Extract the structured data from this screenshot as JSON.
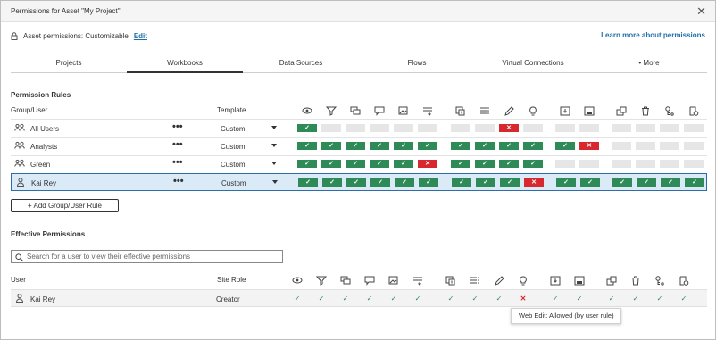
{
  "dialog": {
    "title": "Permissions for Asset \"My Project\"",
    "close_glyph": "✕",
    "asset_permissions_label": "Asset permissions: Customizable",
    "edit_link": "Edit",
    "learn_more_link": "Learn more about permissions"
  },
  "tabs": [
    {
      "label": "Projects",
      "active": false
    },
    {
      "label": "Workbooks",
      "active": true
    },
    {
      "label": "Data Sources",
      "active": false
    },
    {
      "label": "Flows",
      "active": false
    },
    {
      "label": "Virtual Connections",
      "active": false
    },
    {
      "label": "• More",
      "active": false
    }
  ],
  "permission_rules": {
    "section_title": "Permission Rules",
    "col_group_user": "Group/User",
    "col_template": "Template",
    "capability_icons": [
      "view-icon",
      "filter-icon",
      "comments-icon",
      "web-comment-icon",
      "export-image-icon",
      "export-data-icon",
      "download-full-data-icon",
      "share-customized-icon",
      "web-edit-icon",
      "explain-data-icon",
      "download-workbook-icon",
      "overwrite-icon",
      "move-icon",
      "delete-icon",
      "set-permissions-icon",
      "run-explain-icon"
    ],
    "more_glyph": "•••",
    "rows": [
      {
        "name": "All Users",
        "icon": "group-icon",
        "template": "Custom",
        "selected": false,
        "cells": [
          "allow",
          "none",
          "none",
          "none",
          "none",
          "none",
          "none",
          "none",
          "deny",
          "none",
          "none",
          "none",
          "none",
          "none",
          "none",
          "none"
        ]
      },
      {
        "name": "Analysts",
        "icon": "group-icon",
        "template": "Custom",
        "selected": false,
        "cells": [
          "allow",
          "allow",
          "allow",
          "allow",
          "allow",
          "allow",
          "allow",
          "allow",
          "allow",
          "allow",
          "allow",
          "deny",
          "none",
          "none",
          "none",
          "none"
        ]
      },
      {
        "name": "Green",
        "icon": "group-icon",
        "template": "Custom",
        "selected": false,
        "cells": [
          "allow",
          "allow",
          "allow",
          "allow",
          "allow",
          "deny",
          "allow",
          "allow",
          "allow",
          "allow",
          "none",
          "none",
          "none",
          "none",
          "none",
          "none"
        ]
      },
      {
        "name": "Kai Rey",
        "icon": "user-icon",
        "template": "Custom",
        "selected": true,
        "cells": [
          "allow",
          "allow",
          "allow",
          "allow",
          "allow",
          "allow",
          "allow",
          "allow",
          "allow",
          "deny",
          "allow",
          "allow",
          "allow",
          "allow",
          "allow",
          "allow"
        ]
      }
    ],
    "allow_glyph": "✓",
    "deny_glyph": "✕",
    "add_button": "+ Add Group/User Rule"
  },
  "effective_permissions": {
    "section_title": "Effective Permissions",
    "search_placeholder": "Search for a user to view their effective permissions",
    "col_user": "User",
    "col_site_role": "Site Role",
    "rows": [
      {
        "name": "Kai Rey",
        "icon": "user-icon",
        "site_role": "Creator",
        "cells": [
          "allow",
          "allow",
          "allow",
          "allow",
          "allow",
          "allow",
          "allow",
          "allow",
          "allow",
          "deny",
          "allow",
          "allow",
          "allow",
          "allow",
          "allow",
          "allow"
        ]
      }
    ],
    "allow_glyph": "✓",
    "deny_glyph": "✕"
  },
  "tooltip": {
    "text": "Web Edit: Allowed (by user rule)"
  },
  "colors": {
    "allow": "#2e8b57",
    "deny": "#d7282f",
    "unset": "#e6e6e6",
    "link": "#1f6fa6",
    "selected_row": "#dbeaf7"
  }
}
